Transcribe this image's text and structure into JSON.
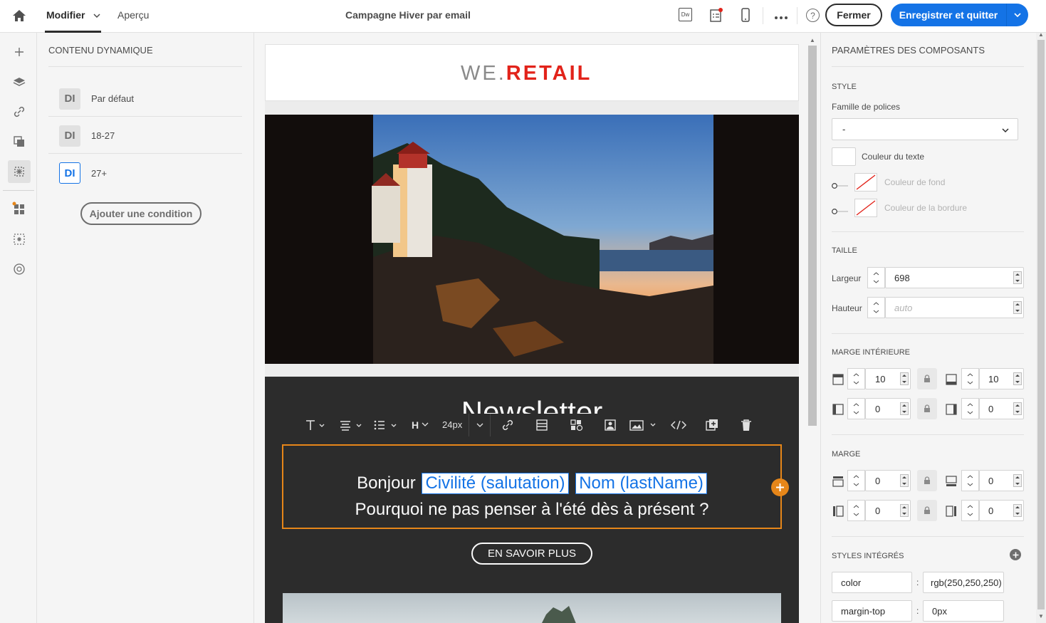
{
  "topbar": {
    "tabs": [
      {
        "label": "Modifier"
      },
      {
        "label": "Aperçu"
      }
    ],
    "title": "Campagne Hiver par email",
    "close_label": "Fermer",
    "save_label": "Enregistrer et quitter",
    "dw_badge": "Dw"
  },
  "left_panel": {
    "title": "CONTENU DYNAMIQUE",
    "items": [
      {
        "badge": "DI",
        "label": "Par défaut"
      },
      {
        "badge": "DI",
        "label": "18-27"
      },
      {
        "badge": "DI",
        "label": "27+"
      }
    ],
    "add_condition": "Ajouter une condition"
  },
  "email": {
    "brand_part1": "WE.",
    "brand_part2": "RETAIL",
    "headline": "Newsletter",
    "greeting": "Bonjour",
    "token_salutation": "Civilité (salutation)",
    "token_lastname": "Nom (lastName)",
    "line2": "Pourquoi ne pas penser à l'été dès à présent ?",
    "cta": "EN SAVOIR PLUS"
  },
  "toolbar": {
    "heading": "H",
    "font_size": "24px"
  },
  "right_panel": {
    "title": "PARAMÈTRES DES COMPOSANTS",
    "style": {
      "heading": "STYLE",
      "font_family_label": "Famille de polices",
      "font_family_value": "-",
      "text_color_label": "Couleur du texte",
      "bg_color_label": "Couleur de fond",
      "border_color_label": "Couleur de la bordure"
    },
    "size": {
      "heading": "TAILLE",
      "width_label": "Largeur",
      "width_value": "698",
      "height_label": "Hauteur",
      "height_placeholder": "auto"
    },
    "padding": {
      "heading": "MARGE INTÉRIEURE",
      "top": "10",
      "bottom": "10",
      "left": "0",
      "right": "0"
    },
    "margin": {
      "heading": "MARGE",
      "top": "0",
      "bottom": "0",
      "left": "0",
      "right": "0"
    },
    "inline_styles": {
      "heading": "STYLES INTÉGRÉS",
      "rows": [
        {
          "key": "color",
          "sep": ":",
          "value": "rgb(250,250,250)"
        },
        {
          "key": "margin-top",
          "sep": ":",
          "value": "0px"
        }
      ]
    }
  },
  "colors": {
    "accent": "#1473e6",
    "brand_red": "#e2231a",
    "selection": "#e68619",
    "email_dark": "#2c2c2c"
  }
}
